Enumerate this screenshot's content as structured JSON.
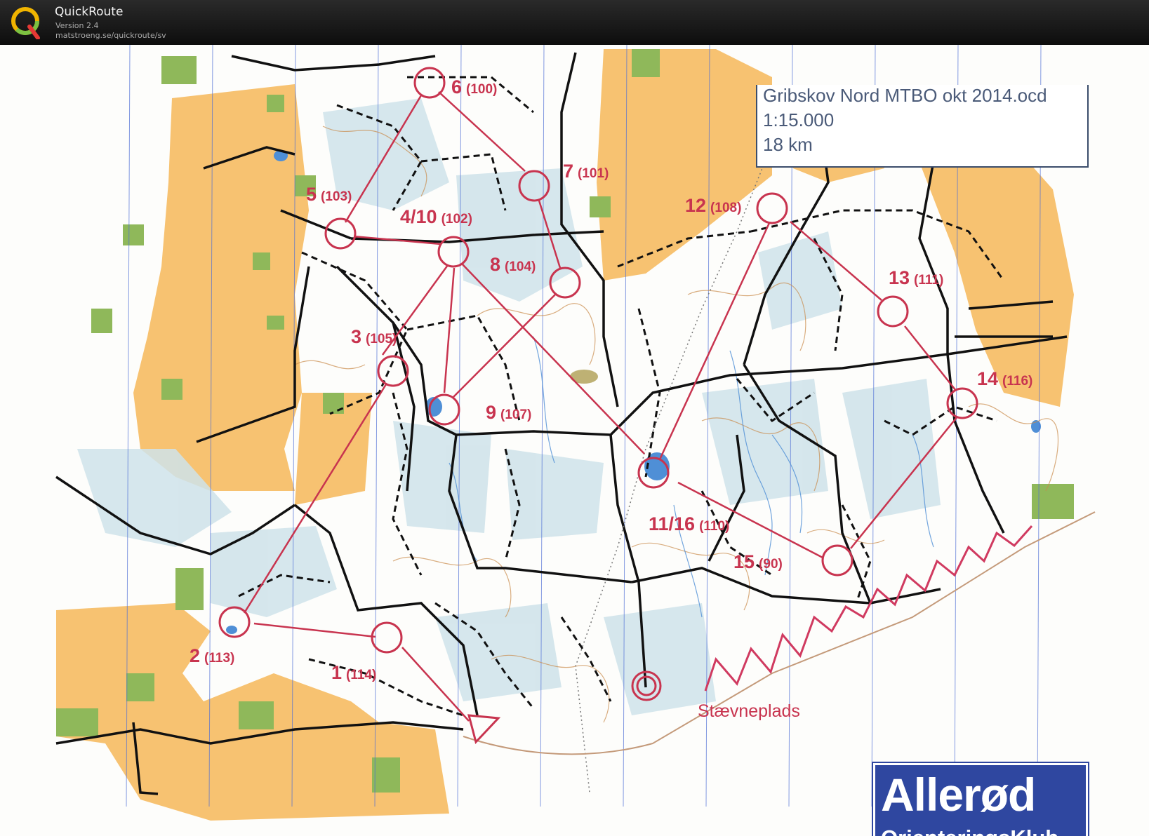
{
  "app": {
    "title": "QuickRoute",
    "version": "Version 2.4",
    "url": "matstroeng.se/quickroute/sv"
  },
  "map_info": {
    "file": "Gribskov Nord MTBO okt 2014.ocd",
    "scale": "1:15.000",
    "distance": "18 km"
  },
  "finish_label": "Stævneplads",
  "club": {
    "name": "Allerød",
    "subtitle": "OrienteringsKlub"
  },
  "colors": {
    "course": "#c8344f",
    "open_land": "#f7c271",
    "green": "#8fb85a",
    "light_blue": "#cfe3ea",
    "water": "#4f8fd6",
    "club_blue": "#2f47a0"
  },
  "controls": [
    {
      "number": "1",
      "code": "(114)"
    },
    {
      "number": "2",
      "code": "(113)"
    },
    {
      "number": "3",
      "code": "(105)"
    },
    {
      "number": "4/10",
      "code": "(102)"
    },
    {
      "number": "5",
      "code": "(103)"
    },
    {
      "number": "6",
      "code": "(100)"
    },
    {
      "number": "7",
      "code": "(101)"
    },
    {
      "number": "8",
      "code": "(104)"
    },
    {
      "number": "9",
      "code": "(107)"
    },
    {
      "number": "11/16",
      "code": "(110)"
    },
    {
      "number": "12",
      "code": "(108)"
    },
    {
      "number": "13",
      "code": "(111)"
    },
    {
      "number": "14",
      "code": "(116)"
    },
    {
      "number": "15",
      "code": "(90)"
    }
  ]
}
